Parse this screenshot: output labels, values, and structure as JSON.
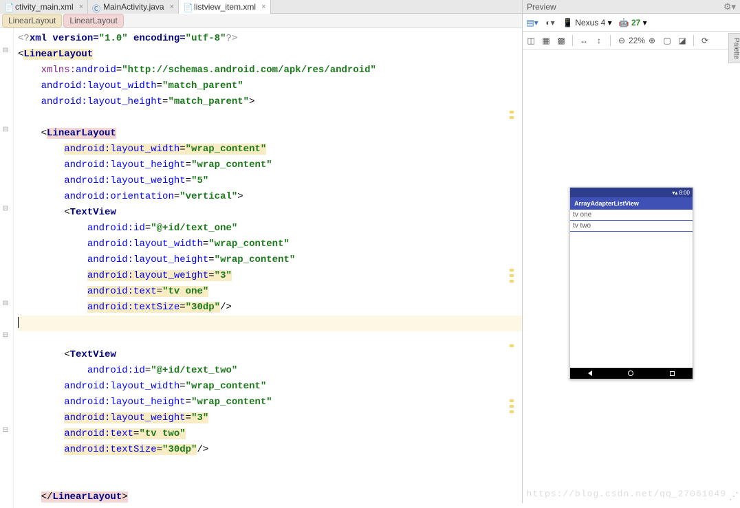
{
  "tabs": [
    {
      "label": "ctivity_main.xml",
      "active": false
    },
    {
      "label": "MainActivity.java",
      "active": false
    },
    {
      "label": "listview_item.xml",
      "active": true
    }
  ],
  "breadcrumb": [
    "LinearLayout",
    "LinearLayout"
  ],
  "code": {
    "xml_decl_open": "<?",
    "xml": "xml version=",
    "ver": "\"1.0\"",
    "enc_lbl": " encoding=",
    "enc": "\"utf-8\"",
    "xml_decl_close": "?>",
    "ll_open": "<",
    "ll": "LinearLayout",
    "xmlns_pre": "xmlns:",
    "xmlns_attr": "android",
    "eq": "=",
    "xmlns_val": "\"http://schemas.android.com/apk/res/android\"",
    "attr_lw": "android:layout_width",
    "attr_lh": "android:layout_height",
    "attr_wt": "android:layout_weight",
    "attr_or": "android:orientation",
    "attr_id": "android:id",
    "attr_txt": "android:text",
    "attr_ts": "android:textSize",
    "val_mp": "\"match_parent\"",
    "val_wc": "\"wrap_content\"",
    "val_5": "\"5\"",
    "val_vert": "\"vertical\"",
    "val_id1": "\"@+id/text_one\"",
    "val_id2": "\"@+id/text_two\"",
    "val_3": "\"3\"",
    "val_tv1": "\"tv one\"",
    "val_tv2": "\"tv two\"",
    "val_30dp": "\"30dp\"",
    "tv": "TextView",
    "gt": ">",
    "selfclose": "/>",
    "close_open": "</",
    "ns_pre": "android:"
  },
  "preview": {
    "title": "Preview",
    "device": "Nexus 4",
    "api": "27",
    "zoom": "22%",
    "app_title": "ArrayAdapterListView",
    "status_time": "8:00",
    "rows": [
      "tv one",
      "tv two"
    ]
  },
  "watermark": "https://blog.csdn.net/qq_27061049",
  "palette_label": "Palette"
}
